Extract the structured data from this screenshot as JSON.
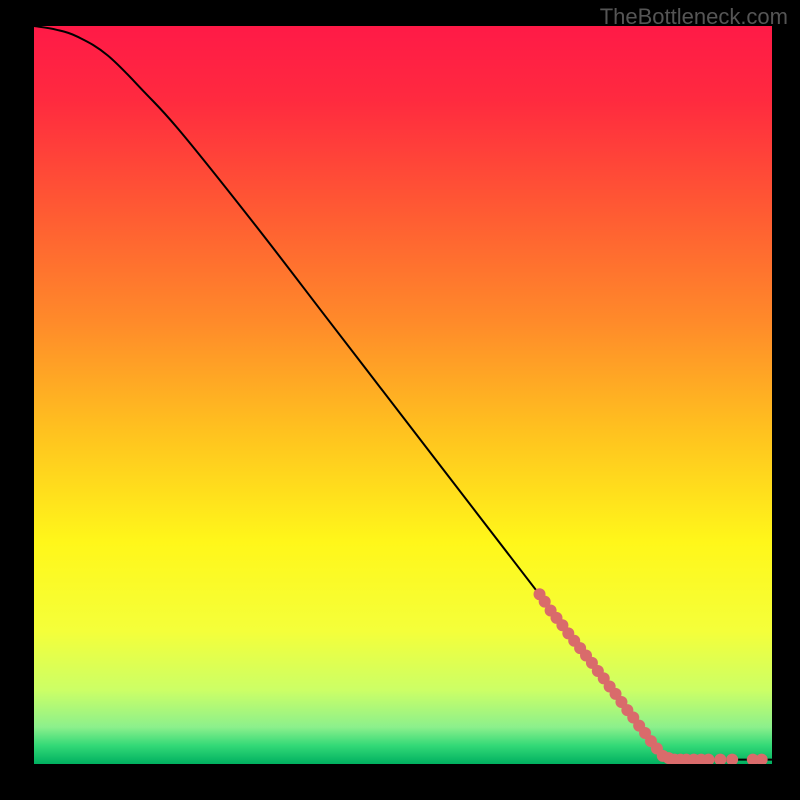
{
  "watermark": "TheBottleneck.com",
  "chart_data": {
    "type": "line",
    "title": "",
    "xlabel": "",
    "ylabel": "",
    "xlim": [
      0,
      100
    ],
    "ylim": [
      0,
      100
    ],
    "grid": false,
    "background_gradient": {
      "stops": [
        {
          "offset": 0.0,
          "color": "#ff1a47"
        },
        {
          "offset": 0.1,
          "color": "#ff2a3f"
        },
        {
          "offset": 0.25,
          "color": "#ff5a33"
        },
        {
          "offset": 0.4,
          "color": "#ff8a2a"
        },
        {
          "offset": 0.55,
          "color": "#ffc21f"
        },
        {
          "offset": 0.7,
          "color": "#fff71a"
        },
        {
          "offset": 0.82,
          "color": "#f4ff3a"
        },
        {
          "offset": 0.9,
          "color": "#ccff66"
        },
        {
          "offset": 0.95,
          "color": "#8cf08c"
        },
        {
          "offset": 0.975,
          "color": "#33d977"
        },
        {
          "offset": 1.0,
          "color": "#00b060"
        }
      ]
    },
    "series": [
      {
        "name": "curve",
        "type": "line",
        "color": "#000000",
        "width": 2,
        "points": [
          {
            "x": 0,
            "y": 100
          },
          {
            "x": 3,
            "y": 99.5
          },
          {
            "x": 6,
            "y": 98.5
          },
          {
            "x": 10,
            "y": 96
          },
          {
            "x": 15,
            "y": 91
          },
          {
            "x": 20,
            "y": 85.5
          },
          {
            "x": 30,
            "y": 73
          },
          {
            "x": 40,
            "y": 60
          },
          {
            "x": 50,
            "y": 47
          },
          {
            "x": 60,
            "y": 34
          },
          {
            "x": 70,
            "y": 21
          },
          {
            "x": 80,
            "y": 8
          },
          {
            "x": 85,
            "y": 1.2
          },
          {
            "x": 87,
            "y": 0.6
          },
          {
            "x": 90,
            "y": 0.6
          },
          {
            "x": 95,
            "y": 0.6
          },
          {
            "x": 100,
            "y": 0.6
          }
        ]
      },
      {
        "name": "dots",
        "type": "scatter",
        "color": "#d96b6b",
        "radius": 6,
        "points": [
          {
            "x": 68.5,
            "y": 23.0
          },
          {
            "x": 69.2,
            "y": 22.0
          },
          {
            "x": 70.0,
            "y": 20.8
          },
          {
            "x": 70.8,
            "y": 19.8
          },
          {
            "x": 71.6,
            "y": 18.8
          },
          {
            "x": 72.4,
            "y": 17.7
          },
          {
            "x": 73.2,
            "y": 16.7
          },
          {
            "x": 74.0,
            "y": 15.7
          },
          {
            "x": 74.8,
            "y": 14.7
          },
          {
            "x": 75.6,
            "y": 13.7
          },
          {
            "x": 76.4,
            "y": 12.6
          },
          {
            "x": 77.2,
            "y": 11.6
          },
          {
            "x": 78.0,
            "y": 10.5
          },
          {
            "x": 78.8,
            "y": 9.5
          },
          {
            "x": 79.6,
            "y": 8.4
          },
          {
            "x": 80.4,
            "y": 7.3
          },
          {
            "x": 81.2,
            "y": 6.3
          },
          {
            "x": 82.0,
            "y": 5.2
          },
          {
            "x": 82.8,
            "y": 4.2
          },
          {
            "x": 83.6,
            "y": 3.1
          },
          {
            "x": 84.4,
            "y": 2.1
          },
          {
            "x": 85.2,
            "y": 1.1
          },
          {
            "x": 86.0,
            "y": 0.8
          },
          {
            "x": 86.8,
            "y": 0.6
          },
          {
            "x": 87.6,
            "y": 0.6
          },
          {
            "x": 88.4,
            "y": 0.6
          },
          {
            "x": 89.4,
            "y": 0.6
          },
          {
            "x": 90.4,
            "y": 0.6
          },
          {
            "x": 91.4,
            "y": 0.6
          },
          {
            "x": 93.0,
            "y": 0.6
          },
          {
            "x": 94.6,
            "y": 0.6
          },
          {
            "x": 97.4,
            "y": 0.6
          },
          {
            "x": 98.6,
            "y": 0.6
          }
        ]
      }
    ]
  }
}
